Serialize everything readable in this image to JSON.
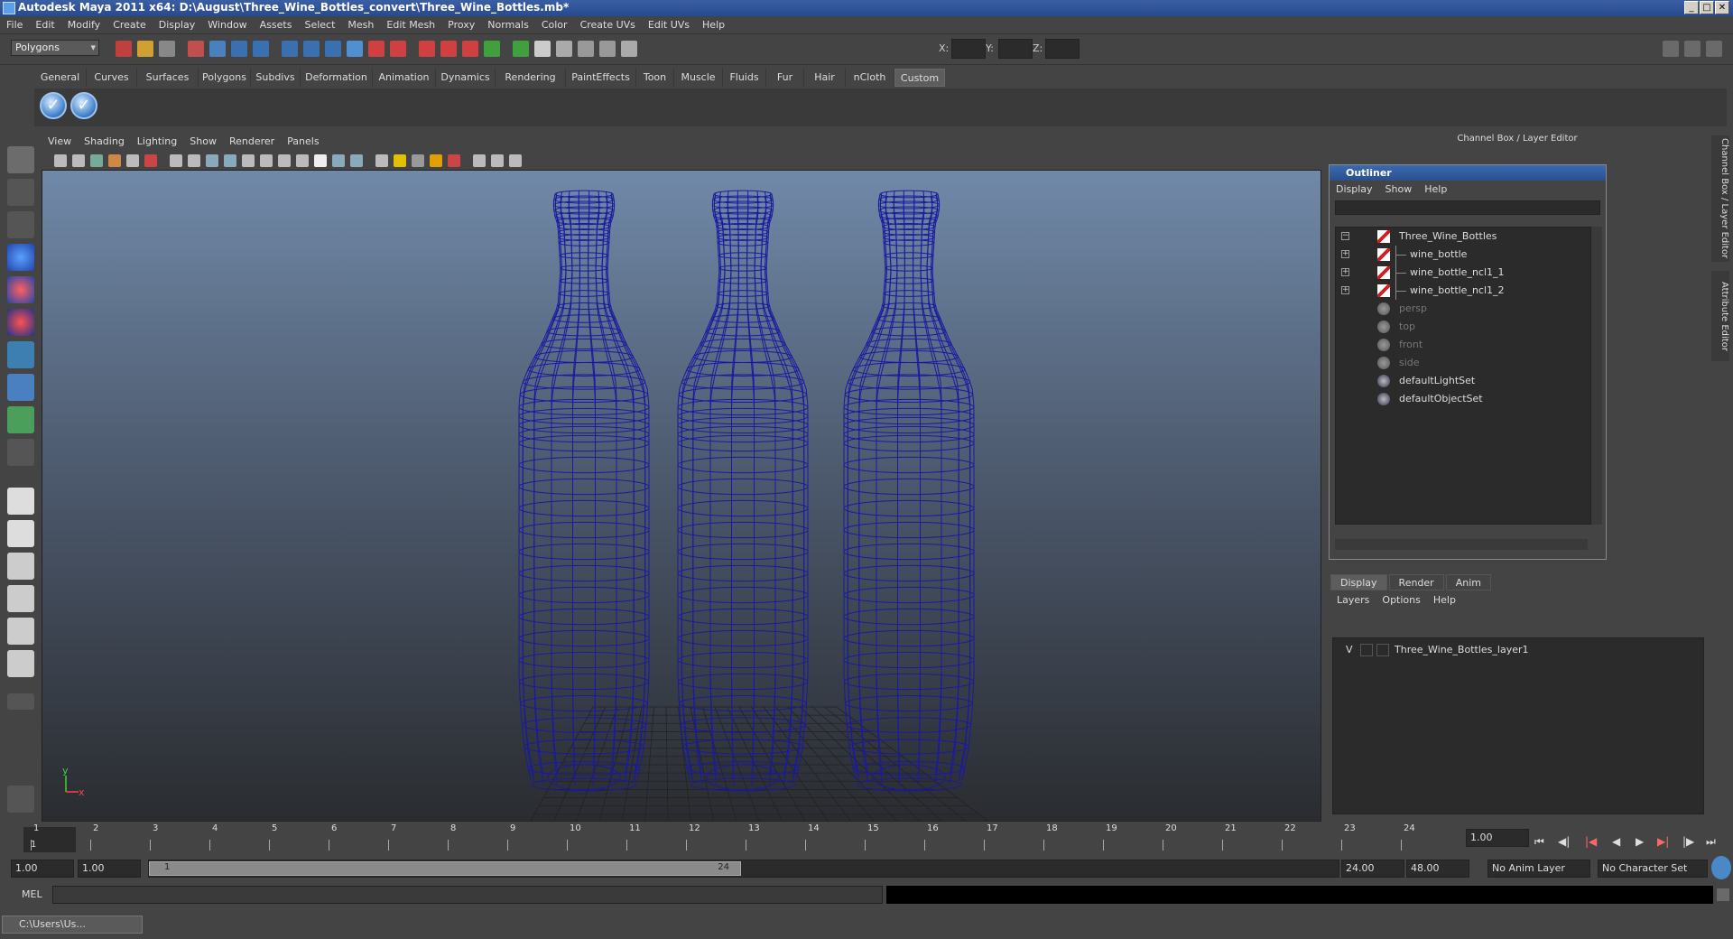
{
  "window": {
    "title": "Autodesk Maya 2011 x64: D:\\August\\Three_Wine_Bottles_convert\\Three_Wine_Bottles.mb*",
    "buttons": [
      "_",
      "□",
      "✕"
    ]
  },
  "menubar": [
    "File",
    "Edit",
    "Modify",
    "Create",
    "Display",
    "Window",
    "Assets",
    "Select",
    "Mesh",
    "Edit Mesh",
    "Proxy",
    "Normals",
    "Color",
    "Create UVs",
    "Edit UVs",
    "Help"
  ],
  "statusline": {
    "mode_select": "Polygons",
    "x_label": "X:",
    "y_label": "Y:",
    "z_label": "Z:"
  },
  "shelf_tabs": [
    "General",
    "Curves",
    "Surfaces",
    "Polygons",
    "Subdivs",
    "Deformation",
    "Animation",
    "Dynamics",
    "Rendering",
    "PaintEffects",
    "Toon",
    "Muscle",
    "Fluids",
    "Fur",
    "Hair",
    "nCloth",
    "Custom"
  ],
  "shelf_active": "Custom",
  "viewport": {
    "menu": [
      "View",
      "Shading",
      "Lighting",
      "Show",
      "Renderer",
      "Panels"
    ],
    "axis_y": "y",
    "axis_x": "x",
    "wire_color": "#1a1aa0"
  },
  "right_panel": {
    "header": "Channel Box / Layer Editor",
    "side_tabs": [
      "Channel Box / Layer Editor",
      "Attribute Editor"
    ]
  },
  "outliner": {
    "title": "Outliner",
    "menu": [
      "Display",
      "Show",
      "Help"
    ],
    "items": [
      {
        "label": "Three_Wine_Bottles",
        "expand": "−",
        "icon": "transform-icon",
        "indent": 0,
        "dim": false
      },
      {
        "label": "wine_bottle",
        "expand": "+",
        "icon": "transform-icon",
        "indent": 1,
        "dim": false
      },
      {
        "label": "wine_bottle_ncl1_1",
        "expand": "+",
        "icon": "transform-icon",
        "indent": 1,
        "dim": false
      },
      {
        "label": "wine_bottle_ncl1_2",
        "expand": "+",
        "icon": "transform-icon",
        "indent": 1,
        "dim": false
      },
      {
        "label": "persp",
        "expand": "",
        "icon": "camera-icon",
        "indent": 0,
        "dim": true
      },
      {
        "label": "top",
        "expand": "",
        "icon": "camera-icon",
        "indent": 0,
        "dim": true
      },
      {
        "label": "front",
        "expand": "",
        "icon": "camera-icon",
        "indent": 0,
        "dim": true
      },
      {
        "label": "side",
        "expand": "",
        "icon": "camera-icon",
        "indent": 0,
        "dim": true
      },
      {
        "label": "defaultLightSet",
        "expand": "",
        "icon": "set-icon",
        "indent": 0,
        "dim": false
      },
      {
        "label": "defaultObjectSet",
        "expand": "",
        "icon": "set-icon",
        "indent": 0,
        "dim": false
      }
    ]
  },
  "layer_editor": {
    "tabs": [
      "Display",
      "Render",
      "Anim"
    ],
    "menu": [
      "Layers",
      "Options",
      "Help"
    ],
    "layer_visible": "V",
    "layer_name": "Three_Wine_Bottles_layer1"
  },
  "timeline": {
    "ticks": [
      "1",
      "2",
      "3",
      "4",
      "5",
      "6",
      "7",
      "8",
      "9",
      "10",
      "11",
      "12",
      "13",
      "14",
      "15",
      "16",
      "17",
      "18",
      "19",
      "20",
      "21",
      "22",
      "23",
      "24"
    ],
    "current_frame_marker": "1",
    "current_time": "1.00"
  },
  "range": {
    "start_time": "1.00",
    "playback_start": "1.00",
    "range_start": "1",
    "range_end": "24",
    "playback_end": "24.00",
    "end_time": "48.00",
    "anim_layer": "No Anim Layer",
    "character_set": "No Character Set"
  },
  "mel": {
    "label": "MEL"
  },
  "taskbar": {
    "button": "C:\\Users\\Us..."
  }
}
